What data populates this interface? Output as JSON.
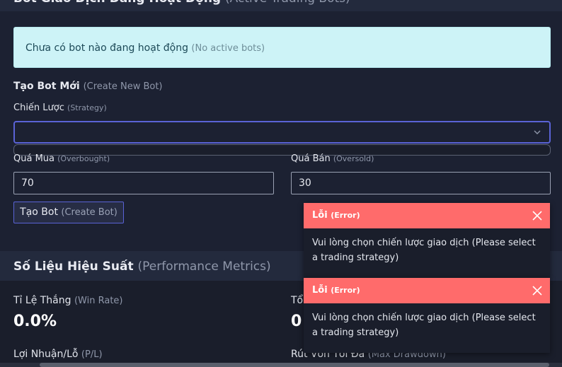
{
  "active_bots": {
    "title": "Bot Giao Dịch Đang Hoạt Động",
    "title_sub": "(Active Trading Bots)",
    "empty_text": "Chưa có bot nào đang hoạt động",
    "empty_sub": "(No active bots)"
  },
  "create_bot": {
    "title": "Tạo Bot Mới",
    "title_sub": "(Create New Bot)",
    "strategy_label": "Chiến Lược",
    "strategy_sub": "(Strategy)",
    "strategy_value": "",
    "overbought_label": "Quá Mua",
    "overbought_sub": "(Overbought)",
    "overbought_value": "70",
    "oversold_label": "Quá Bán",
    "oversold_sub": "(Oversold)",
    "oversold_value": "30",
    "button_label": "Tạo Bot",
    "button_sub": "(Create Bot)"
  },
  "metrics": {
    "title": "Số Liệu Hiệu Suất",
    "title_sub": "(Performance Metrics)",
    "win_rate_label": "Tỉ Lệ Thắng",
    "win_rate_sub": "(Win Rate)",
    "win_rate_value": "0.0%",
    "total_label": "Tổ",
    "total_value": "0",
    "pl_label": "Lợi Nhuận/Lỗ",
    "pl_sub": "(P/L)",
    "drawdown_label": "Rút Vốn Tối Đa",
    "drawdown_sub": "(Max Drawdown)"
  },
  "toasts": [
    {
      "title": "Lỗi",
      "title_sub": "(Error)",
      "message": "Vui lòng chọn chiến lược giao dịch (Please select a trading strategy)"
    },
    {
      "title": "Lỗi",
      "title_sub": "(Error)",
      "message": "Vui lòng chọn chiến lược giao dịch (Please select a trading strategy)"
    }
  ],
  "colors": {
    "accent": "#5a63d6",
    "error": "#ff6b6b",
    "info_bg": "#cdf3f7"
  },
  "icons": {
    "close": "close-icon",
    "chevron": "chevron-down-icon"
  }
}
